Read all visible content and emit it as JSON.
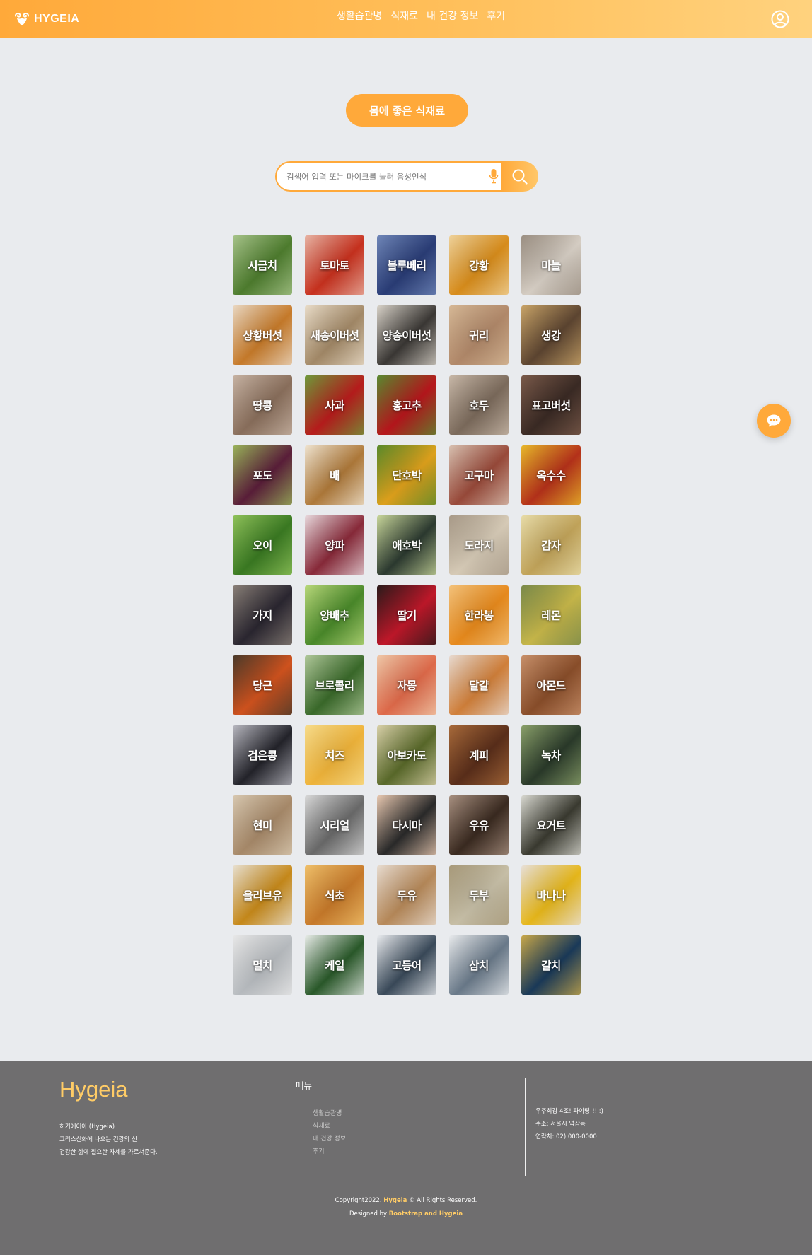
{
  "header": {
    "logo_text": "HYGEIA",
    "nav": [
      "생활습관병",
      "식재료",
      "내 건강 정보",
      "후기"
    ]
  },
  "main": {
    "title": "몸에 좋은 식재료",
    "search": {
      "placeholder": "검색어 입력 또는 마이크를 눌러 음성인식"
    },
    "ingredients": [
      {
        "label": "시금치",
        "color1": "#4e7d2e",
        "color2": "#a7c48a"
      },
      {
        "label": "토마토",
        "color1": "#c9311e",
        "color2": "#e8b3a3"
      },
      {
        "label": "블루베리",
        "color1": "#2a3d77",
        "color2": "#6f86b8"
      },
      {
        "label": "강황",
        "color1": "#d98d1b",
        "color2": "#efd29a"
      },
      {
        "label": "마늘",
        "color1": "#d7cfc5",
        "color2": "#9b8f82"
      },
      {
        "label": "상황버섯",
        "color1": "#c87b2a",
        "color2": "#ead8c2"
      },
      {
        "label": "새송이버섯",
        "color1": "#a48a68",
        "color2": "#e9dcc8"
      },
      {
        "label": "양송이버섯",
        "color1": "#3b3835",
        "color2": "#d8d2c8"
      },
      {
        "label": "귀리",
        "color1": "#b2896a",
        "color2": "#d6b896"
      },
      {
        "label": "생강",
        "color1": "#5d4531",
        "color2": "#c9a468"
      },
      {
        "label": "땅콩",
        "color1": "#8a6f5c",
        "color2": "#c7b3a3"
      },
      {
        "label": "사과",
        "color1": "#b91c1c",
        "color2": "#6f9a3a"
      },
      {
        "label": "홍고추",
        "color1": "#b8161c",
        "color2": "#5a8a30"
      },
      {
        "label": "호두",
        "color1": "#7c6b5c",
        "color2": "#c8b8a8"
      },
      {
        "label": "표고버섯",
        "color1": "#3a2a24",
        "color2": "#7a5a4a"
      },
      {
        "label": "포도",
        "color1": "#5b1e3a",
        "color2": "#9ab45a"
      },
      {
        "label": "배",
        "color1": "#b07a3a",
        "color2": "#efe3cf"
      },
      {
        "label": "단호박",
        "color1": "#e0a21c",
        "color2": "#5a8a2a"
      },
      {
        "label": "고구마",
        "color1": "#9a4a3a",
        "color2": "#d8c0b0"
      },
      {
        "label": "옥수수",
        "color1": "#b6311a",
        "color2": "#e8b82a"
      },
      {
        "label": "오이",
        "color1": "#3a7a22",
        "color2": "#8fc25a"
      },
      {
        "label": "양파",
        "color1": "#8a2a3a",
        "color2": "#e8d8dc"
      },
      {
        "label": "애호박",
        "color1": "#2c3a30",
        "color2": "#c8d69a"
      },
      {
        "label": "도라지",
        "color1": "#d8ccb8",
        "color2": "#a89a88"
      },
      {
        "label": "감자",
        "color1": "#c2a45a",
        "color2": "#e8dca8"
      },
      {
        "label": "가지",
        "color1": "#2a2630",
        "color2": "#8a8078"
      },
      {
        "label": "양배추",
        "color1": "#4a8a2a",
        "color2": "#b8d87a"
      },
      {
        "label": "딸기",
        "color1": "#c2182a",
        "color2": "#2a1a1a"
      },
      {
        "label": "한라봉",
        "color1": "#e88a1c",
        "color2": "#f4c27a"
      },
      {
        "label": "레몬",
        "color1": "#c8b84a",
        "color2": "#7a8a4a"
      },
      {
        "label": "당근",
        "color1": "#d2531e",
        "color2": "#4a3a2a"
      },
      {
        "label": "브로콜리",
        "color1": "#3a6a2a",
        "color2": "#b0c89a"
      },
      {
        "label": "자몽",
        "color1": "#e06a4a",
        "color2": "#f0c8a8"
      },
      {
        "label": "달걀",
        "color1": "#d2803a",
        "color2": "#e8dad0"
      },
      {
        "label": "아몬드",
        "color1": "#8a4e2a",
        "color2": "#c8906a"
      },
      {
        "label": "검은콩",
        "color1": "#23232a",
        "color2": "#b8b8c0"
      },
      {
        "label": "치즈",
        "color1": "#f0b43a",
        "color2": "#f8dc8a"
      },
      {
        "label": "아보카도",
        "color1": "#5a6a2a",
        "color2": "#d8d0a8"
      },
      {
        "label": "계피",
        "color1": "#5a2e1a",
        "color2": "#a86a3a"
      },
      {
        "label": "녹차",
        "color1": "#2a3a2a",
        "color2": "#8aa06a"
      },
      {
        "label": "현미",
        "color1": "#a88a6a",
        "color2": "#d8c8b0"
      },
      {
        "label": "시리얼",
        "color1": "#6a6a6a",
        "color2": "#d8d8d8"
      },
      {
        "label": "다시마",
        "color1": "#2a2a2a",
        "color2": "#e8c8b0"
      },
      {
        "label": "우유",
        "color1": "#3a2a20",
        "color2": "#a89080"
      },
      {
        "label": "요거트",
        "color1": "#3a3a30",
        "color2": "#d8d8d0"
      },
      {
        "label": "올리브유",
        "color1": "#c88a1a",
        "color2": "#e8e0d0"
      },
      {
        "label": "식초",
        "color1": "#c87a2a",
        "color2": "#f0c06a"
      },
      {
        "label": "두유",
        "color1": "#b88a5a",
        "color2": "#e8dcd0"
      },
      {
        "label": "두부",
        "color1": "#c8c0a8",
        "color2": "#a89a7a"
      },
      {
        "label": "바나나",
        "color1": "#e8b81a",
        "color2": "#e8e0d8"
      },
      {
        "label": "멸치",
        "color1": "#b8bcc0",
        "color2": "#e8e8e8"
      },
      {
        "label": "케일",
        "color1": "#2a5a2a",
        "color2": "#e8ece8"
      },
      {
        "label": "고등어",
        "color1": "#3a4a5a",
        "color2": "#e9ebee"
      },
      {
        "label": "삼치",
        "color1": "#6a7a8a",
        "color2": "#e8eaec"
      },
      {
        "label": "갈치",
        "color1": "#1a3a5a",
        "color2": "#c8a84a"
      }
    ]
  },
  "footer": {
    "brand": "Hygeia",
    "desc": [
      "히기에이아 (Hygeia)",
      "그리스신화에 나오는 건강의 신",
      "건강한 삶에 필요한 자세를 가르쳐준다."
    ],
    "menu_title": "메뉴",
    "menu": [
      "생활습관병",
      "식재료",
      "내 건강 정보",
      "후기"
    ],
    "info": [
      "우주최강 4조! 파이팅!!! :)",
      "주소: 서울시 역삼동",
      "연락처: 02) 000-0000"
    ],
    "copyright_prefix": "Copyright2022.",
    "copyright_brand": "Hygeia",
    "copyright_suffix": "© All Rights Reserved.",
    "designed_prefix": "Designed by",
    "designed_by": "Bootstrap and Hygeia"
  },
  "colors": {
    "accent": "#ffa93a",
    "accent_light": "#ffd27e",
    "footer_bg": "#6f6e6f",
    "page_bg": "#e9ebee"
  }
}
